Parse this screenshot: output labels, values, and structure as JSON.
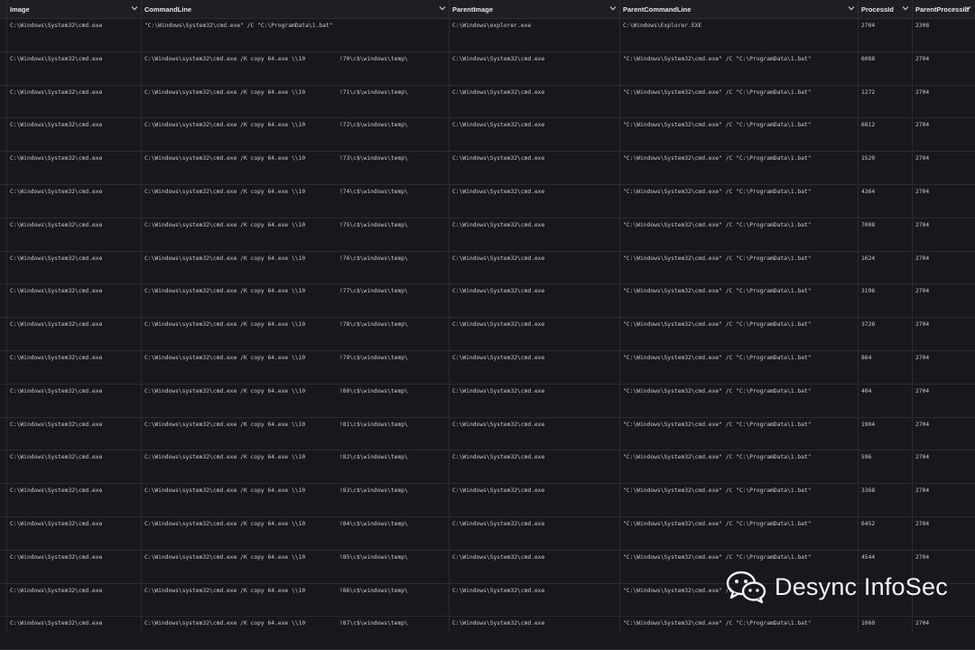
{
  "columns": [
    {
      "key": "image",
      "label": "Image"
    },
    {
      "key": "cmd",
      "label": "CommandLine"
    },
    {
      "key": "pimage",
      "label": "ParentImage"
    },
    {
      "key": "pcmd",
      "label": "ParentCommandLine"
    },
    {
      "key": "pid",
      "label": "ProcessId"
    },
    {
      "key": "ppid",
      "label": "ParentProcessId"
    }
  ],
  "rows": [
    {
      "image": "C:\\Windows\\System32\\cmd.exe",
      "cmd_a": "\"C:\\Windows\\System32\\cmd.exe\" /C \"C:\\ProgramData\\1.bat\"",
      "cmd_b": "",
      "pimage": "C:\\Windows\\explorer.exe",
      "pcmd": "C:\\Windows\\Explorer.EXE",
      "pid": "2704",
      "ppid": "2308"
    },
    {
      "image": "C:\\Windows\\System32\\cmd.exe",
      "cmd_a": "C:\\Windows\\system32\\cmd.exe /K copy 64.exe \\\\10",
      "cmd_b": "!70\\c$\\windows\\temp\\",
      "pimage": "C:\\Windows\\System32\\cmd.exe",
      "pcmd": "\"C:\\Windows\\System32\\cmd.exe\" /C \"C:\\ProgramData\\1.bat\"",
      "pid": "6088",
      "ppid": "2704"
    },
    {
      "image": "C:\\Windows\\System32\\cmd.exe",
      "cmd_a": "C:\\Windows\\system32\\cmd.exe /K copy 64.exe \\\\10",
      "cmd_b": "!71\\c$\\windows\\temp\\",
      "pimage": "C:\\Windows\\System32\\cmd.exe",
      "pcmd": "\"C:\\Windows\\System32\\cmd.exe\" /C \"C:\\ProgramData\\1.bat\"",
      "pid": "1272",
      "ppid": "2704"
    },
    {
      "image": "C:\\Windows\\System32\\cmd.exe",
      "cmd_a": "C:\\Windows\\system32\\cmd.exe /K copy 64.exe \\\\10",
      "cmd_b": "!72\\c$\\windows\\temp\\",
      "pimage": "C:\\Windows\\System32\\cmd.exe",
      "pcmd": "\"C:\\Windows\\System32\\cmd.exe\" /C \"C:\\ProgramData\\1.bat\"",
      "pid": "6812",
      "ppid": "2704"
    },
    {
      "image": "C:\\Windows\\System32\\cmd.exe",
      "cmd_a": "C:\\Windows\\system32\\cmd.exe /K copy 64.exe \\\\10",
      "cmd_b": "!73\\c$\\windows\\temp\\",
      "pimage": "C:\\Windows\\System32\\cmd.exe",
      "pcmd": "\"C:\\Windows\\System32\\cmd.exe\" /C \"C:\\ProgramData\\1.bat\"",
      "pid": "1520",
      "ppid": "2704"
    },
    {
      "image": "C:\\Windows\\System32\\cmd.exe",
      "cmd_a": "C:\\Windows\\system32\\cmd.exe /K copy 64.exe \\\\10",
      "cmd_b": "!74\\c$\\windows\\temp\\",
      "pimage": "C:\\Windows\\System32\\cmd.exe",
      "pcmd": "\"C:\\Windows\\System32\\cmd.exe\" /C \"C:\\ProgramData\\1.bat\"",
      "pid": "4364",
      "ppid": "2704"
    },
    {
      "image": "C:\\Windows\\System32\\cmd.exe",
      "cmd_a": "C:\\Windows\\system32\\cmd.exe /K copy 64.exe \\\\10",
      "cmd_b": "!75\\c$\\windows\\temp\\",
      "pimage": "C:\\Windows\\System32\\cmd.exe",
      "pcmd": "\"C:\\Windows\\System32\\cmd.exe\" /C \"C:\\ProgramData\\1.bat\"",
      "pid": "7008",
      "ppid": "2704"
    },
    {
      "image": "C:\\Windows\\System32\\cmd.exe",
      "cmd_a": "C:\\Windows\\system32\\cmd.exe /K copy 64.exe \\\\10",
      "cmd_b": "!76\\c$\\windows\\temp\\",
      "pimage": "C:\\Windows\\System32\\cmd.exe",
      "pcmd": "\"C:\\Windows\\System32\\cmd.exe\" /C \"C:\\ProgramData\\1.bat\"",
      "pid": "1624",
      "ppid": "2704"
    },
    {
      "image": "C:\\Windows\\System32\\cmd.exe",
      "cmd_a": "C:\\Windows\\system32\\cmd.exe /K copy 64.exe \\\\10",
      "cmd_b": "!77\\c$\\windows\\temp\\",
      "pimage": "C:\\Windows\\System32\\cmd.exe",
      "pcmd": "\"C:\\Windows\\System32\\cmd.exe\" /C \"C:\\ProgramData\\1.bat\"",
      "pid": "3196",
      "ppid": "2704"
    },
    {
      "image": "C:\\Windows\\System32\\cmd.exe",
      "cmd_a": "C:\\Windows\\system32\\cmd.exe /K copy 64.exe \\\\10",
      "cmd_b": "!78\\c$\\windows\\temp\\",
      "pimage": "C:\\Windows\\System32\\cmd.exe",
      "pcmd": "\"C:\\Windows\\System32\\cmd.exe\" /C \"C:\\ProgramData\\1.bat\"",
      "pid": "3728",
      "ppid": "2704"
    },
    {
      "image": "C:\\Windows\\System32\\cmd.exe",
      "cmd_a": "C:\\Windows\\system32\\cmd.exe /K copy 64.exe \\\\10",
      "cmd_b": "!79\\c$\\windows\\temp\\",
      "pimage": "C:\\Windows\\System32\\cmd.exe",
      "pcmd": "\"C:\\Windows\\System32\\cmd.exe\" /C \"C:\\ProgramData\\1.bat\"",
      "pid": "864",
      "ppid": "2704"
    },
    {
      "image": "C:\\Windows\\System32\\cmd.exe",
      "cmd_a": "C:\\Windows\\system32\\cmd.exe /K copy 64.exe \\\\10",
      "cmd_b": "!80\\c$\\windows\\temp\\",
      "pimage": "C:\\Windows\\System32\\cmd.exe",
      "pcmd": "\"C:\\Windows\\System32\\cmd.exe\" /C \"C:\\ProgramData\\1.bat\"",
      "pid": "404",
      "ppid": "2704"
    },
    {
      "image": "C:\\Windows\\System32\\cmd.exe",
      "cmd_a": "C:\\Windows\\system32\\cmd.exe /K copy 64.exe \\\\10",
      "cmd_b": "!81\\c$\\windows\\temp\\",
      "pimage": "C:\\Windows\\System32\\cmd.exe",
      "pcmd": "\"C:\\Windows\\System32\\cmd.exe\" /C \"C:\\ProgramData\\1.bat\"",
      "pid": "1904",
      "ppid": "2704"
    },
    {
      "image": "C:\\Windows\\System32\\cmd.exe",
      "cmd_a": "C:\\Windows\\system32\\cmd.exe /K copy 64.exe \\\\10",
      "cmd_b": "!82\\c$\\windows\\temp\\",
      "pimage": "C:\\Windows\\System32\\cmd.exe",
      "pcmd": "\"C:\\Windows\\System32\\cmd.exe\" /C \"C:\\ProgramData\\1.bat\"",
      "pid": "596",
      "ppid": "2704"
    },
    {
      "image": "C:\\Windows\\System32\\cmd.exe",
      "cmd_a": "C:\\Windows\\system32\\cmd.exe /K copy 64.exe \\\\10",
      "cmd_b": "!83\\c$\\windows\\temp\\",
      "pimage": "C:\\Windows\\System32\\cmd.exe",
      "pcmd": "\"C:\\Windows\\System32\\cmd.exe\" /C \"C:\\ProgramData\\1.bat\"",
      "pid": "3368",
      "ppid": "2704"
    },
    {
      "image": "C:\\Windows\\System32\\cmd.exe",
      "cmd_a": "C:\\Windows\\system32\\cmd.exe /K copy 64.exe \\\\10",
      "cmd_b": "!84\\c$\\windows\\temp\\",
      "pimage": "C:\\Windows\\System32\\cmd.exe",
      "pcmd": "\"C:\\Windows\\System32\\cmd.exe\" /C \"C:\\ProgramData\\1.bat\"",
      "pid": "6452",
      "ppid": "2704"
    },
    {
      "image": "C:\\Windows\\System32\\cmd.exe",
      "cmd_a": "C:\\Windows\\system32\\cmd.exe /K copy 64.exe \\\\10",
      "cmd_b": "!85\\c$\\windows\\temp\\",
      "pimage": "C:\\Windows\\System32\\cmd.exe",
      "pcmd": "\"C:\\Windows\\System32\\cmd.exe\" /C \"C:\\ProgramData\\1.bat\"",
      "pid": "4544",
      "ppid": "2704"
    },
    {
      "image": "C:\\Windows\\System32\\cmd.exe",
      "cmd_a": "C:\\Windows\\system32\\cmd.exe /K copy 64.exe \\\\10",
      "cmd_b": "!86\\c$\\windows\\temp\\",
      "pimage": "C:\\Windows\\System32\\cmd.exe",
      "pcmd": "\"C:\\Windows\\System32\\cmd.exe\" /C",
      "pid": "",
      "ppid": ""
    },
    {
      "image": "C:\\Windows\\System32\\cmd.exe",
      "cmd_a": "C:\\Windows\\system32\\cmd.exe /K copy 64.exe \\\\10",
      "cmd_b": "!87\\c$\\windows\\temp\\",
      "pimage": "C:\\Windows\\System32\\cmd.exe",
      "pcmd": "\"C:\\Windows\\System32\\cmd.exe\" /C \"C:\\ProgramData\\1.bat\"",
      "pid": "1060",
      "ppid": "2704"
    }
  ],
  "watermark": {
    "text": "Desync InfoSec",
    "icon": "wechat-icon"
  },
  "colors": {
    "background": "#17181c",
    "header": "#1e1f24",
    "border": "#2a2c32",
    "text": "#c7cad0"
  }
}
